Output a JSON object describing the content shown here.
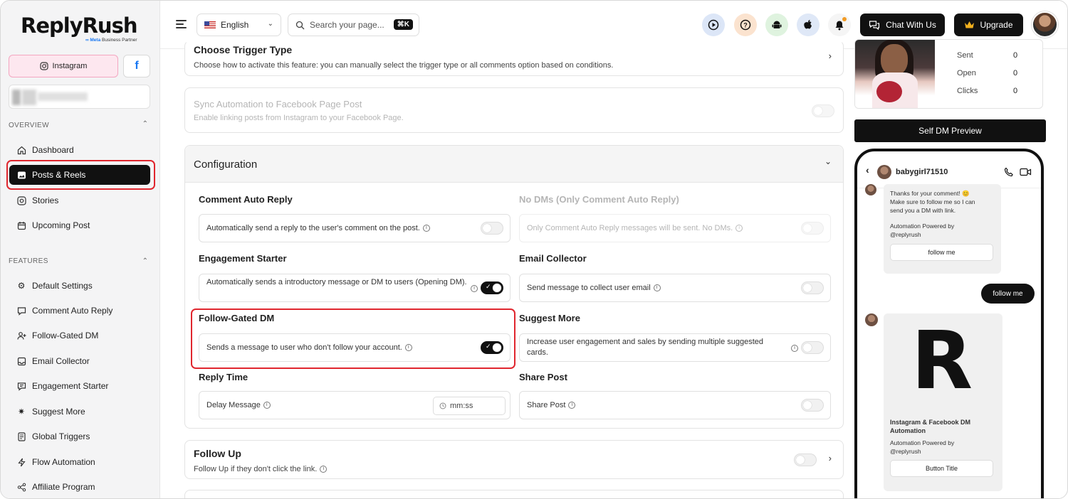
{
  "brand": {
    "logo": "ReplyRush",
    "sub_meta": "∞ Meta",
    "sub_partner": "Business Partner"
  },
  "sidebar": {
    "tab_instagram": "Instagram",
    "tab_facebook": "f",
    "overview_label": "OVERVIEW",
    "features_label": "FEATURES",
    "overview_items": [
      {
        "label": "Dashboard"
      },
      {
        "label": "Posts & Reels"
      },
      {
        "label": "Stories"
      },
      {
        "label": "Upcoming Post"
      }
    ],
    "feature_items": [
      {
        "label": "Default Settings"
      },
      {
        "label": "Comment Auto Reply"
      },
      {
        "label": "Follow-Gated DM"
      },
      {
        "label": "Email Collector"
      },
      {
        "label": "Engagement Starter"
      },
      {
        "label": "Suggest More"
      },
      {
        "label": "Global Triggers"
      },
      {
        "label": "Flow Automation"
      },
      {
        "label": "Affiliate Program"
      }
    ]
  },
  "header": {
    "language": "English",
    "search_placeholder": "Search your page...",
    "search_shortcut": "⌘K",
    "chat_label": "Chat With Us",
    "upgrade_label": "Upgrade"
  },
  "main": {
    "trigger": {
      "title": "Choose Trigger Type",
      "desc": "Choose how to activate this feature: you can manually select the trigger type or all comments option based on conditions."
    },
    "sync": {
      "title": "Sync Automation to Facebook Page Post",
      "desc": "Enable linking posts from Instagram to your Facebook Page.",
      "enabled": false
    },
    "configuration": {
      "title": "Configuration",
      "comment_auto_reply": {
        "label": "Comment Auto Reply",
        "text": "Automatically send a reply to the user's comment on the post.",
        "enabled": false
      },
      "no_dms": {
        "label": "No DMs (Only Comment Auto Reply)",
        "text": "Only Comment Auto Reply messages will be sent. No DMs.",
        "enabled": false
      },
      "engagement_starter": {
        "label": "Engagement Starter",
        "text": "Automatically sends a introductory message or DM to users (Opening DM).",
        "enabled": true
      },
      "email_collector": {
        "label": "Email Collector",
        "text": "Send message to collect user email",
        "enabled": false
      },
      "follow_gated": {
        "label": "Follow-Gated DM",
        "text": "Sends a message to user who don't follow your account.",
        "enabled": true
      },
      "suggest_more": {
        "label": "Suggest More",
        "text": "Increase user engagement and sales by sending multiple suggested cards.",
        "enabled": false
      },
      "reply_time": {
        "label": "Reply Time",
        "text": "Delay Message",
        "placeholder": "mm:ss"
      },
      "share_post": {
        "label": "Share Post",
        "text": "Share Post",
        "enabled": false
      }
    },
    "follow_up": {
      "title": "Follow Up",
      "desc": "Follow Up if they don't click the link.",
      "enabled": false
    }
  },
  "right": {
    "stats": [
      {
        "label": "Sent",
        "value": "0"
      },
      {
        "label": "Open",
        "value": "0"
      },
      {
        "label": "Clicks",
        "value": "0"
      }
    ],
    "preview_button": "Self DM Preview",
    "phone": {
      "username": "babygirl71510",
      "msg1_line1": "Thanks for your comment! 😊",
      "msg1_line2": "Make sure to follow me so I can",
      "msg1_line3": "send you a DM with link.",
      "powered1": "Automation Powered by",
      "handle1": "@replyrush",
      "follow_btn": "follow me",
      "sent_reply": "follow me",
      "card_letter": "R",
      "card_title": "Instagram & Facebook DM Automation",
      "powered2": "Automation Powered by",
      "handle2": "@replyrush",
      "card_btn": "Button Title"
    }
  },
  "colors": {
    "accent": "#111111",
    "highlight": "#e0262e",
    "instagram_bg": "#fde7ef",
    "facebook": "#1877f2"
  }
}
